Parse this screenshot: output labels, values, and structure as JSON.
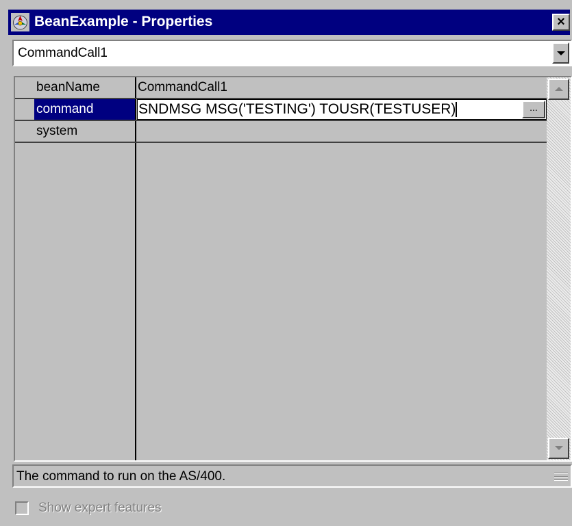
{
  "window": {
    "title": "BeanExample - Properties",
    "icon": "java-bean-icon",
    "close_label": "×"
  },
  "bean_selector": {
    "selected": "CommandCall1"
  },
  "properties": [
    {
      "name": "beanName",
      "value": "CommandCall1",
      "selected": false
    },
    {
      "name": "command",
      "value": "SNDMSG MSG('TESTING') TOUSR(TESTUSER)",
      "selected": true
    },
    {
      "name": "system",
      "value": "",
      "selected": false
    }
  ],
  "editor": {
    "ellipsis_label": "..."
  },
  "description": {
    "text": "The command to run on the AS/400."
  },
  "expert": {
    "label": "Show expert features",
    "checked": false,
    "enabled": false
  },
  "colors": {
    "title_bar": "#000080",
    "selection": "#000080",
    "face": "#c0c0c0"
  }
}
